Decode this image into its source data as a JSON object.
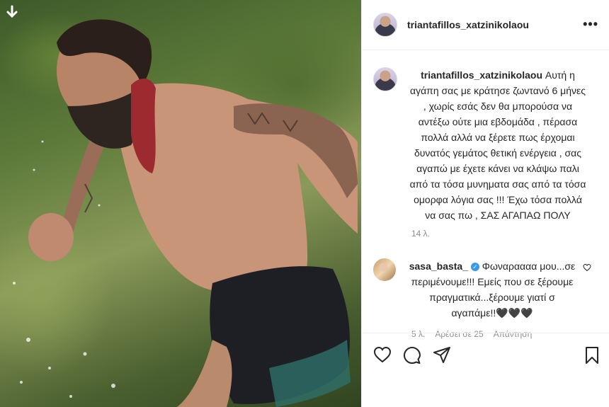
{
  "post": {
    "username": "triantafillos_xatzinikolaou",
    "caption": "Αυτή η αγάπη σας με κράτησε ζωντανό 6 μήνες , χωρίς εσάς δεν θα μπορούσα να αντέξω ούτε μια εβδομάδα , πέρασα πολλά αλλά να ξέρετε πως έρχομαι δυνατός γεμάτος θετική ενέργεια , σας αγαπώ με έχετε κάνει να κλάψω παλι από τα τόσα μυνηματα σας από τα τόσα ομορφα λόγια σας !!! Έχω τόσα πολλά να σας πω , ΣΑΣ ΑΓΑΠΑΩ ΠΟΛΥ",
    "time": "14 λ."
  },
  "comment": {
    "username": "sasa_basta_",
    "verified": "✓",
    "text": "Φωναραααα μου...σε περιμένουμε!!! Εμείς που σε ξέρουμε πραγματικά...ξέρουμε γιατί σ αγαπάμε!!🖤🖤🖤",
    "time": "5 λ.",
    "likes": "Αρέσει σε 25",
    "reply": "Απάντηση"
  },
  "icons": {
    "download": "download-arrow-icon",
    "more": "more-options-icon",
    "like": "heart-icon",
    "comment": "comment-bubble-icon",
    "share": "paper-plane-icon",
    "save": "bookmark-icon"
  }
}
